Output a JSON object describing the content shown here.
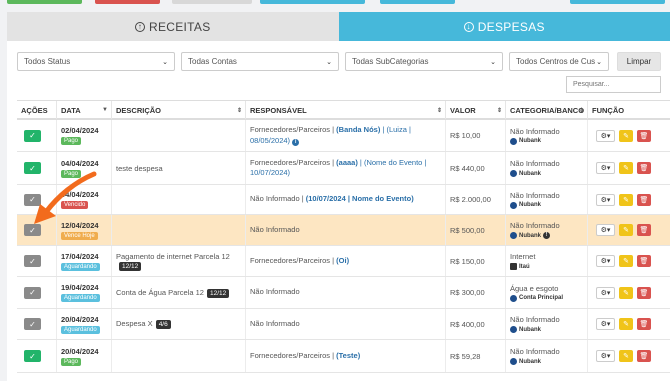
{
  "tabs": {
    "receitas": "RECEITAS",
    "despesas": "DESPESAS"
  },
  "filters": {
    "status": "Todos Status",
    "contas": "Todas Contas",
    "subcategorias": "Todas SubCategorias",
    "centros": "Todos Centros de Cus",
    "limpar": "Limpar",
    "search_placeholder": "Pesquisar..."
  },
  "table": {
    "headers": {
      "acoes": "AÇÕES",
      "data": "DATA",
      "descricao": "DESCRIÇÃO",
      "responsavel": "RESPONSÁVEL",
      "valor": "VALOR",
      "categoria": "CATEGORIA/BANCO",
      "funcao": "FUNÇÃO"
    },
    "rows": [
      {
        "date": "02/04/2024",
        "status": "Pago",
        "desc": "",
        "parcel": "",
        "resp_plain": "Fornecedores/Parceiros | ",
        "resp_bold": "(Banda Nós)",
        "resp_link": " | (Luiza | 08/05/2024)",
        "resp_info": "i",
        "value": "R$ 10,00",
        "category": "Não Informado",
        "bank": "Nubank"
      },
      {
        "date": "04/04/2024",
        "status": "Pago",
        "desc": "teste despesa",
        "parcel": "",
        "resp_plain": "Fornecedores/Parceiros | ",
        "resp_bold": "(aaaa)",
        "resp_link": " | (Nome do Evento | 10/07/2024)",
        "resp_info": "",
        "value": "R$ 440,00",
        "category": "Não Informado",
        "bank": "Nubank"
      },
      {
        "date": "04/04/2024",
        "status": "Vencido",
        "desc": "",
        "parcel": "",
        "resp_plain": "Não Informado | ",
        "resp_bold": "(10/07/2024 | Nome do Evento)",
        "resp_link": "",
        "resp_info": "",
        "value": "R$ 2.000,00",
        "category": "Não Informado",
        "bank": "Nubank"
      },
      {
        "date": "12/04/2024",
        "status": "Vence Hoje",
        "desc": "",
        "parcel": "",
        "resp_plain": "Não Informado",
        "resp_bold": "",
        "resp_link": "",
        "resp_info": "",
        "value": "R$ 500,00",
        "category": "Não Informado",
        "bank": "Nubank"
      },
      {
        "date": "17/04/2024",
        "status": "Aguardando",
        "desc": "Pagamento de internet Parcela 12",
        "parcel": "12/12",
        "resp_plain": "Fornecedores/Parceiros | ",
        "resp_bold": "(Oi)",
        "resp_link": "",
        "resp_info": "",
        "value": "R$ 150,00",
        "category": "Internet",
        "bank": "Itaú"
      },
      {
        "date": "19/04/2024",
        "status": "Aguardando",
        "desc": "Conta de Água Parcela 12",
        "parcel": "12/12",
        "resp_plain": "Não Informado",
        "resp_bold": "",
        "resp_link": "",
        "resp_info": "",
        "value": "R$ 300,00",
        "category": "Água e esgoto",
        "bank": "Conta Principal"
      },
      {
        "date": "20/04/2024",
        "status": "Aguardando",
        "desc": "Despesa X",
        "parcel": "4/6",
        "resp_plain": "Não Informado",
        "resp_bold": "",
        "resp_link": "",
        "resp_info": "",
        "value": "R$ 400,00",
        "category": "Não Informado",
        "bank": "Nubank"
      },
      {
        "date": "20/04/2024",
        "status": "Pago",
        "desc": "",
        "parcel": "",
        "resp_plain": "Fornecedores/Parceiros | ",
        "resp_bold": "(Teste)",
        "resp_link": "",
        "resp_info": "",
        "value": "R$ 59,28",
        "category": "Não Informado",
        "bank": "Nubank"
      }
    ]
  },
  "colors": {
    "accent": "#46b8da",
    "pago": "#5cb85c",
    "vencido": "#d9534f",
    "vence": "#f0ad4e",
    "aguardando": "#5bc0de",
    "arrow": "#f26b1d"
  }
}
